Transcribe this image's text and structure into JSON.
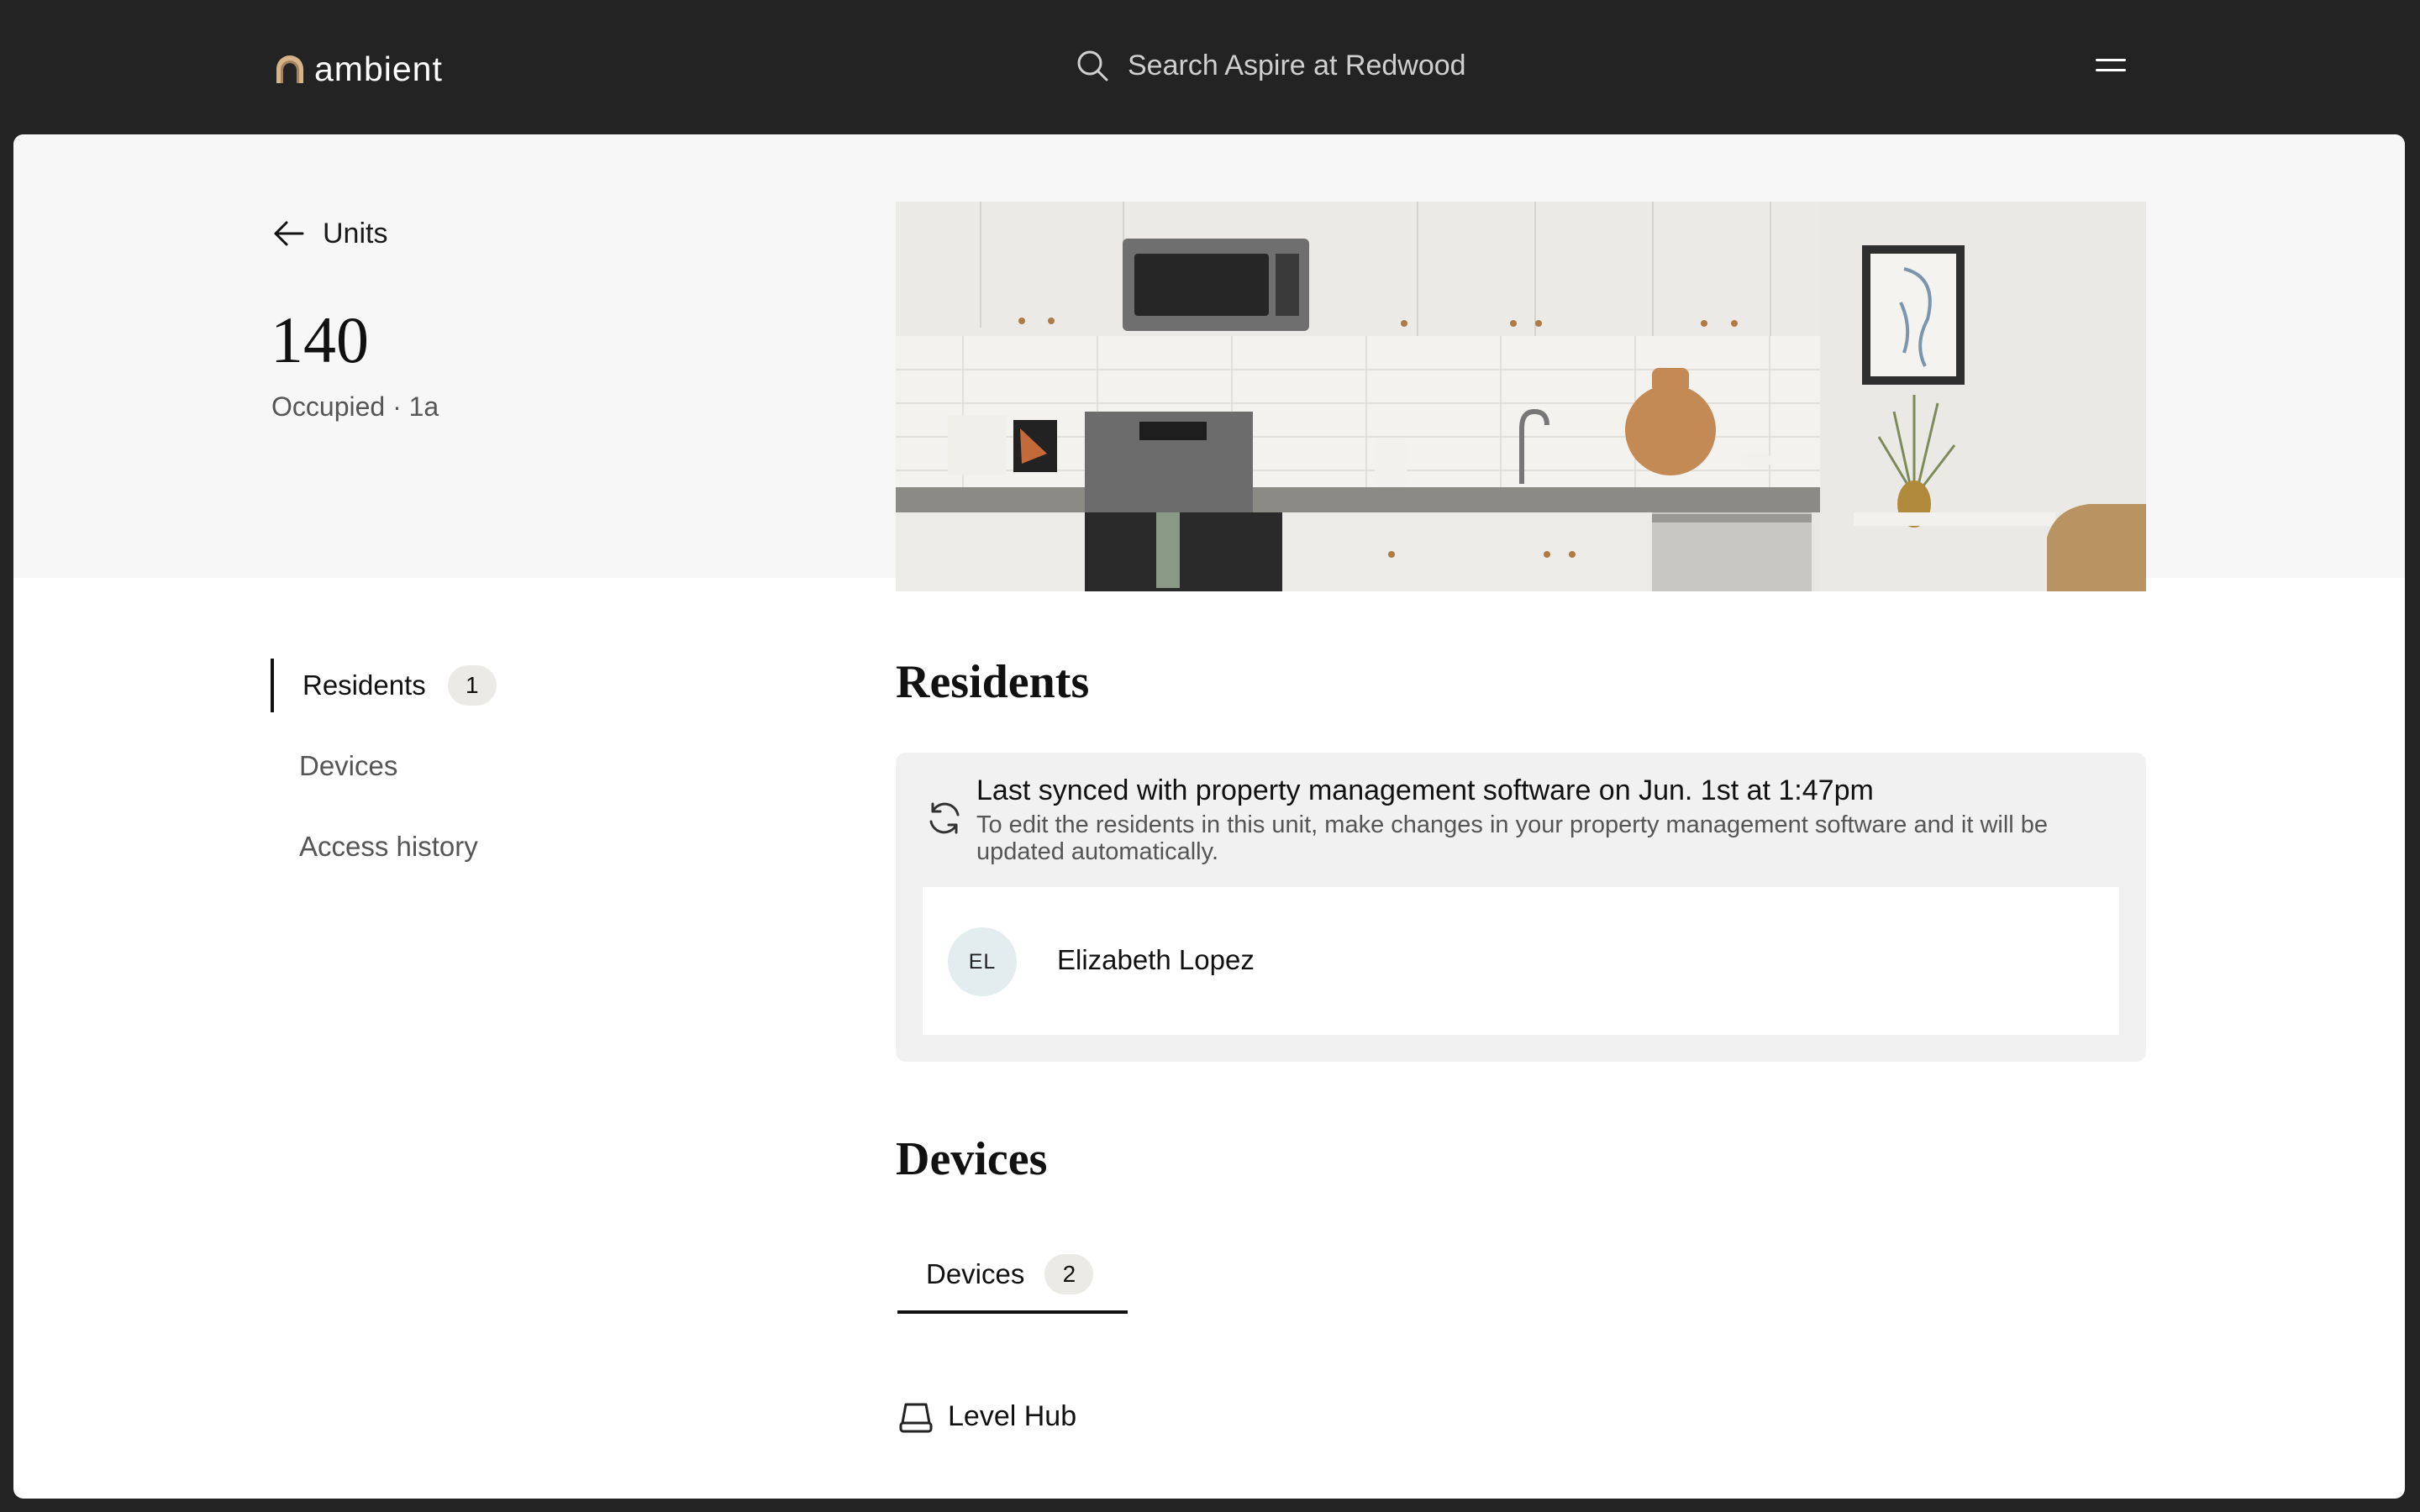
{
  "header": {
    "logo_text": "ambient",
    "search_placeholder": "Search Aspire at Redwood"
  },
  "unit": {
    "back_label": "Units",
    "number": "140",
    "status": "Occupied · 1a"
  },
  "side_nav": {
    "items": [
      {
        "label": "Residents",
        "count": "1",
        "active": true
      },
      {
        "label": "Devices"
      },
      {
        "label": "Access history"
      }
    ]
  },
  "residents": {
    "heading": "Residents",
    "sync_title": "Last synced with property management software on Jun. 1st at 1:47pm",
    "sync_description": "To edit the residents in this unit, make changes in your property management software and it will be updated automatically.",
    "list": [
      {
        "initials": "EL",
        "name": "Elizabeth Lopez"
      }
    ]
  },
  "devices": {
    "heading": "Devices",
    "tab_label": "Devices",
    "tab_count": "2",
    "list": [
      {
        "name": "Level Hub"
      }
    ]
  },
  "colors": {
    "topbar": "#232323",
    "hero_background": "#f7f7f7",
    "badge": "#eceae6",
    "sync_panel": "#f1f1f1",
    "avatar": "#e3ecef",
    "logo_accent": "#d6b48a"
  }
}
